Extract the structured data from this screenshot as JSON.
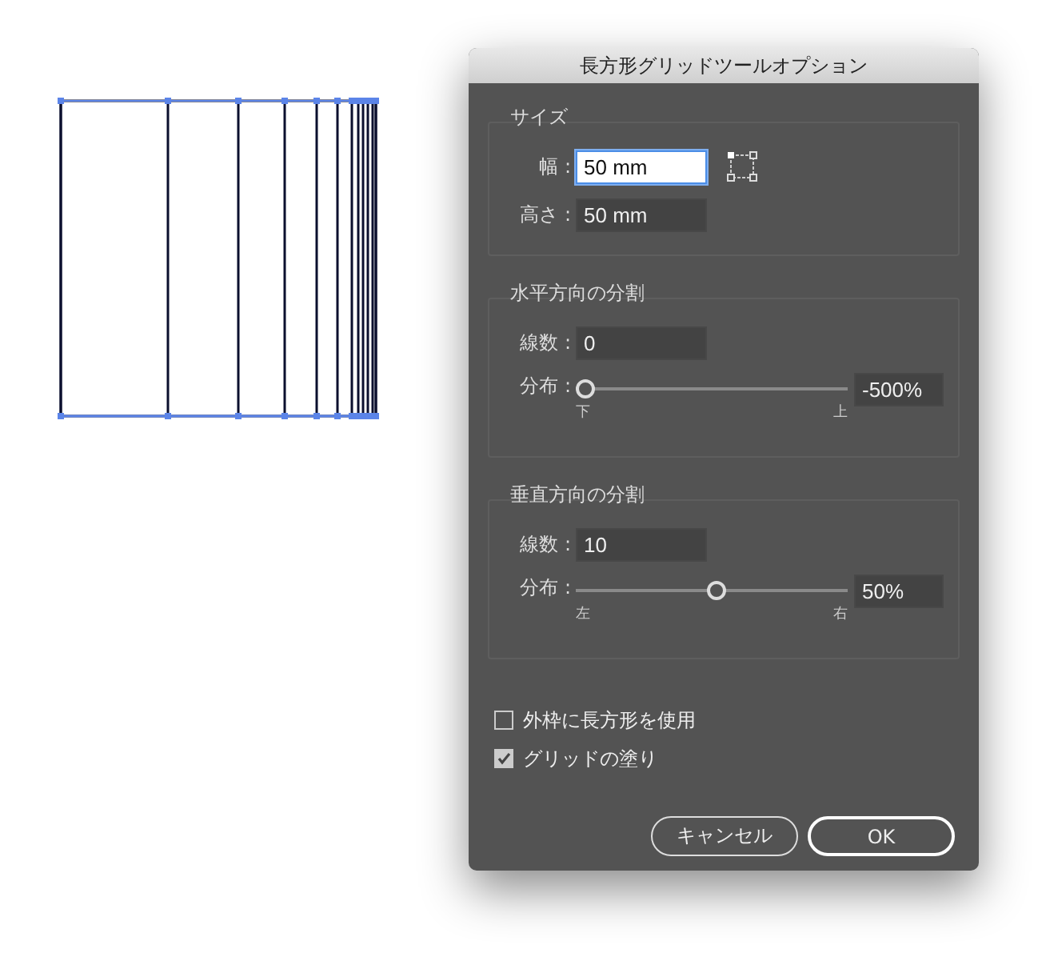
{
  "dialog": {
    "title": "長方形グリッドツールオプション"
  },
  "size": {
    "legend": "サイズ",
    "fields": [
      {
        "label": "幅 :",
        "value": "50 mm",
        "focused": true
      },
      {
        "label": "高さ :",
        "value": "50 mm",
        "focused": false
      }
    ]
  },
  "sections": [
    {
      "legend": "水平方向の分割",
      "count_label": "線数 :",
      "count": "0",
      "skew_label": "分布 :",
      "level": 0,
      "reading": "-500%",
      "min_label": "下",
      "max_label": "上"
    },
    {
      "legend": "垂直方向の分割",
      "count_label": "線数 :",
      "count": "10",
      "skew_label": "分布 :",
      "level": 0.52,
      "reading": "50%",
      "min_label": "左",
      "max_label": "右"
    }
  ],
  "options": [
    {
      "label": "外枠に長方形を使用",
      "checked": false
    },
    {
      "label": "グリッドの塗り",
      "checked": true
    }
  ],
  "buttons": [
    {
      "label": "キャンセル",
      "default": false
    },
    {
      "label": "OK",
      "default": true
    }
  ]
}
